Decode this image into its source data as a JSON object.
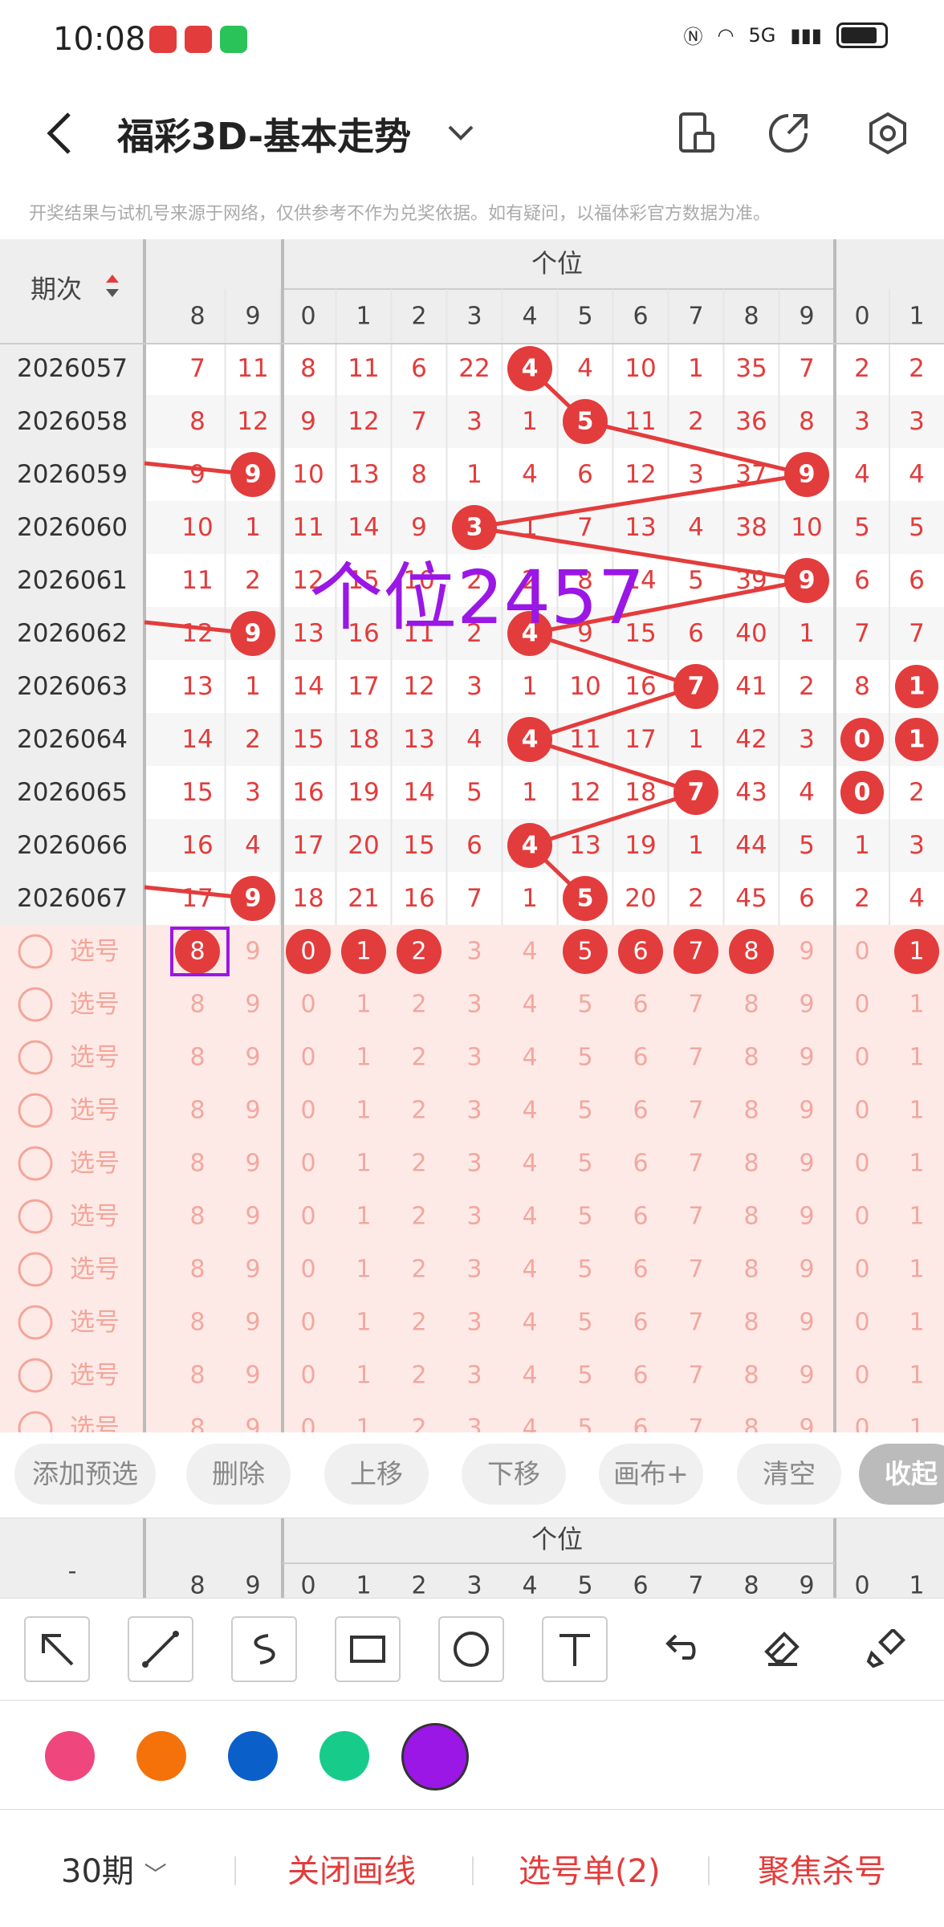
{
  "status": {
    "time": "10:08",
    "network": "5G"
  },
  "nav": {
    "title": "福彩3D-基本走势"
  },
  "disclaimer": "开奖结果与试机号来源于网络，仅供参考不作为兑奖依据。如有疑问，以福体彩官方数据为准。",
  "table": {
    "period_header": "期次",
    "group_title": "个位",
    "col_headers": [
      "8",
      "9",
      "0",
      "1",
      "2",
      "3",
      "4",
      "5",
      "6",
      "7",
      "8",
      "9",
      "0",
      "1"
    ],
    "rows": [
      {
        "period": "2026057",
        "c": [
          "7",
          "11",
          "8",
          "11",
          "6",
          "22",
          "4",
          "4",
          "10",
          "1",
          "35",
          "7",
          "2",
          "2"
        ]
      },
      {
        "period": "2026058",
        "c": [
          "8",
          "12",
          "9",
          "12",
          "7",
          "3",
          "1",
          "5",
          "11",
          "2",
          "36",
          "8",
          "3",
          "3"
        ]
      },
      {
        "period": "2026059",
        "c": [
          "9",
          "9",
          "10",
          "13",
          "8",
          "1",
          "4",
          "6",
          "12",
          "3",
          "37",
          "9",
          "4",
          "4"
        ]
      },
      {
        "period": "2026060",
        "c": [
          "10",
          "1",
          "11",
          "14",
          "9",
          "3",
          "1",
          "7",
          "13",
          "4",
          "38",
          "10",
          "5",
          "5"
        ]
      },
      {
        "period": "2026061",
        "c": [
          "11",
          "2",
          "12",
          "15",
          "10",
          "2",
          "2",
          "8",
          "14",
          "5",
          "39",
          "9",
          "6",
          "6"
        ]
      },
      {
        "period": "2026062",
        "c": [
          "12",
          "9",
          "13",
          "16",
          "11",
          "2",
          "4",
          "9",
          "15",
          "6",
          "40",
          "1",
          "7",
          "7"
        ]
      },
      {
        "period": "2026063",
        "c": [
          "13",
          "1",
          "14",
          "17",
          "12",
          "3",
          "1",
          "10",
          "16",
          "7",
          "41",
          "2",
          "8",
          "1"
        ]
      },
      {
        "period": "2026064",
        "c": [
          "14",
          "2",
          "15",
          "18",
          "13",
          "4",
          "4",
          "11",
          "17",
          "1",
          "42",
          "3",
          "0",
          "1"
        ]
      },
      {
        "period": "2026065",
        "c": [
          "15",
          "3",
          "16",
          "19",
          "14",
          "5",
          "1",
          "12",
          "18",
          "7",
          "43",
          "4",
          "0",
          "2"
        ]
      },
      {
        "period": "2026066",
        "c": [
          "16",
          "4",
          "17",
          "20",
          "15",
          "6",
          "4",
          "13",
          "19",
          "1",
          "44",
          "5",
          "1",
          "3"
        ]
      },
      {
        "period": "2026067",
        "c": [
          "17",
          "9",
          "18",
          "21",
          "16",
          "7",
          "1",
          "5",
          "20",
          "2",
          "45",
          "6",
          "2",
          "4"
        ]
      }
    ],
    "pick_label": "选号",
    "pick_rows": 10,
    "pick_first_selected": [
      true,
      false,
      true,
      true,
      true,
      false,
      false,
      true,
      true,
      true,
      true,
      false,
      false,
      true
    ]
  },
  "overlay_text": "个位2457",
  "actions": [
    "添加预选",
    "删除",
    "上移",
    "下移",
    "画布+",
    "清空",
    "收起"
  ],
  "subhead": {
    "left": "-",
    "group_title": "个位"
  },
  "tools": [
    "arrow-tool",
    "line-tool",
    "curve-tool",
    "rect-tool",
    "circle-tool",
    "text-tool",
    "undo-tool",
    "eraser-tool",
    "clear-tool"
  ],
  "colors": [
    "#f0467e",
    "#f5720a",
    "#0a60c8",
    "#17cc8a",
    "#9a17e6"
  ],
  "bottom": {
    "period": "30期",
    "close": "关闭画线",
    "picks": "选号单(2)",
    "focus": "聚焦杀号"
  }
}
